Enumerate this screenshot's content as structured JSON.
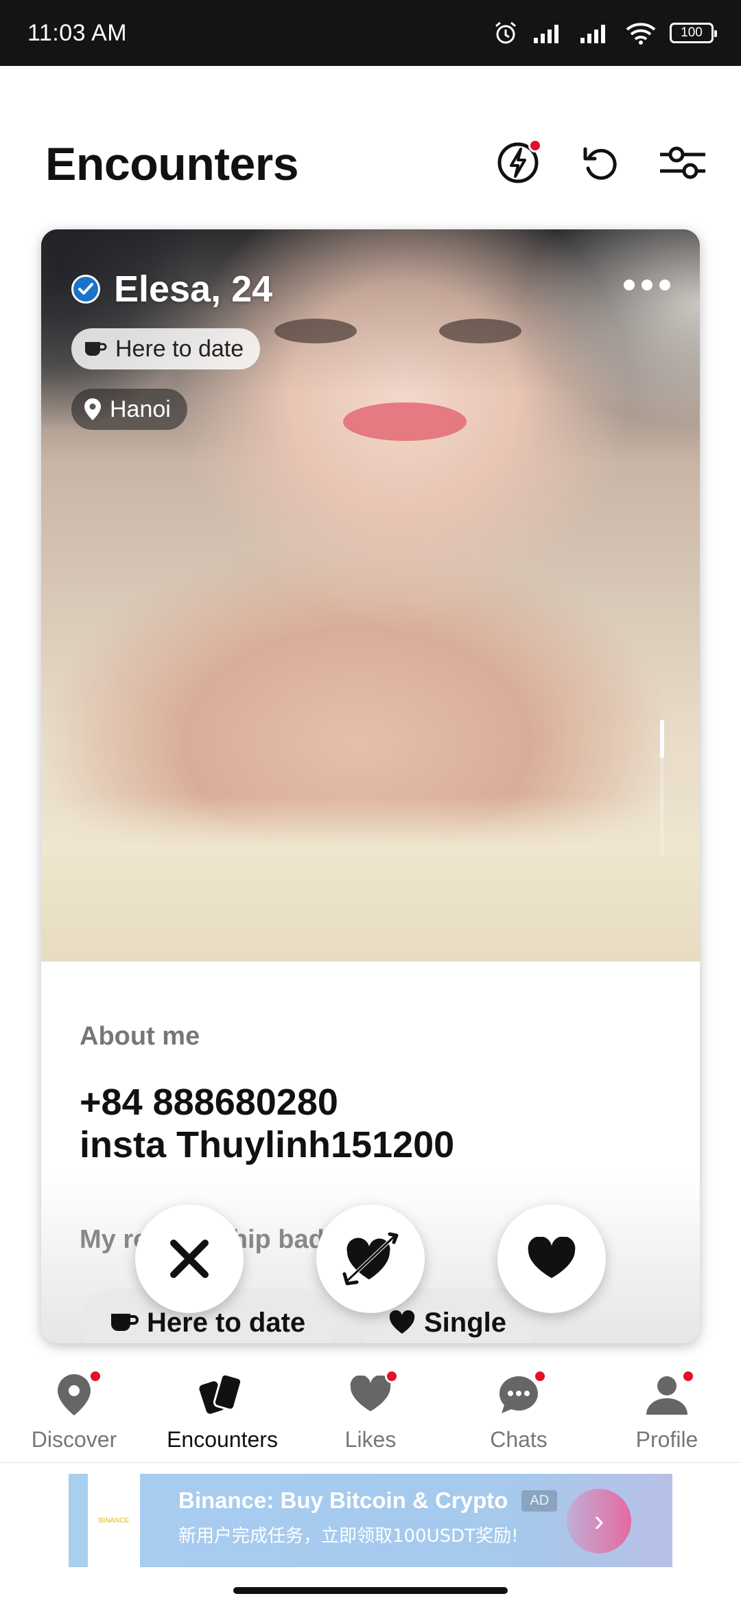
{
  "status_bar": {
    "time": "11:03 AM",
    "battery": "100",
    "icons": [
      "alarm-icon",
      "signal-icon",
      "signal-icon",
      "wifi-icon",
      "battery-icon"
    ]
  },
  "header": {
    "title": "Encounters",
    "icons": [
      "boost-icon",
      "undo-icon",
      "filter-icon"
    ]
  },
  "profile": {
    "name_age": "Elesa, 24",
    "verified": true,
    "intent": "Here to date",
    "location": "Hanoi",
    "about_heading": "About me",
    "about_text": "+84 888680280\ninsta Thuylinh151200",
    "relationship_heading": "My relationship badges",
    "badges": [
      {
        "icon": "coffee-cup-icon",
        "label": "Here to date"
      },
      {
        "icon": "heart-icon",
        "label": "Single"
      }
    ]
  },
  "actions": {
    "pass": "pass-icon",
    "crush": "crush-icon",
    "like": "heart-icon"
  },
  "nav": {
    "items": [
      {
        "label": "Discover",
        "icon": "map-pin-icon",
        "badge": true
      },
      {
        "label": "Encounters",
        "icon": "cards-icon",
        "badge": false,
        "active": true
      },
      {
        "label": "Likes",
        "icon": "heart-icon",
        "badge": true
      },
      {
        "label": "Chats",
        "icon": "chat-bubble-icon",
        "badge": true
      },
      {
        "label": "Profile",
        "icon": "person-icon",
        "badge": true
      }
    ]
  },
  "ad": {
    "title": "Binance: Buy Bitcoin & Crypto",
    "tag": "AD",
    "subtitle": "新用户完成任务，立即领取100USDT奖励!",
    "logo_text": "BINANCE"
  },
  "colors": {
    "accent_red": "#e3102a",
    "verified_blue": "#1a73c8",
    "ad_blue": "#a7cdf0"
  }
}
